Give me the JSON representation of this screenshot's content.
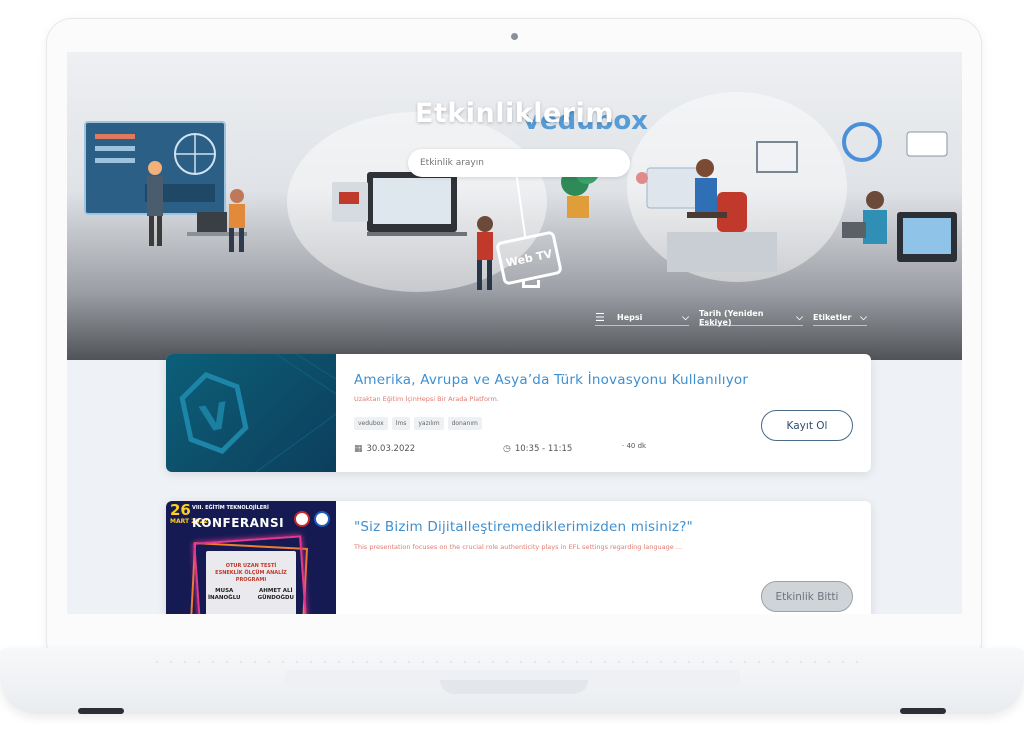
{
  "hero": {
    "title": "Etkinliklerim",
    "brand_logo_text": "vedubox",
    "search_placeholder": "Etkinlik arayın",
    "web_tv_label": "Web TV"
  },
  "filters": {
    "category": "Hepsi",
    "sort": "Tarih (Yeniden Eskiye)",
    "tags": "Etiketler"
  },
  "events": [
    {
      "title": "Amerika, Avrupa ve Asya’da Türk İnovasyonu Kullanılıyor",
      "subtitle": "Uzaktan Eğitim İçinHepsi Bir Arada Platform.",
      "tags": [
        "vedubox",
        "lms",
        "yazılım",
        "donanım"
      ],
      "date": "30.03.2022",
      "time": "10:35 - 11:15",
      "duration": "· 40 dk",
      "button_label": "Kayıt Ol"
    },
    {
      "title": "\"Siz Bizim Dijitalleştiremediklerimizden misiniz?\"",
      "subtitle": "This presentation focuses on the crucial role authenticity plays in EFL settings regarding language ...",
      "button_label": "Etkinlik Bitti",
      "poster": {
        "day": "26",
        "month_year": "MART 2022",
        "heading_small": "VIII. EĞİTİM TEKNOLOJİLERİ",
        "heading": "KONFERANSI",
        "box_line1": "OTUR UZAN TESTİ",
        "box_line2": "ESNEKLİK ÖLÇÜM ANALİZ",
        "box_line3": "PROGRAMI",
        "speaker1_first": "MUSA",
        "speaker1_last": "İNANOĞLU",
        "speaker2_first": "AHMET ALİ",
        "speaker2_last": "GÜNDOĞDU"
      }
    }
  ],
  "colors": {
    "accent": "#3f8fcf",
    "subtitle": "#e27b72",
    "button_border": "#4a6a8a"
  }
}
